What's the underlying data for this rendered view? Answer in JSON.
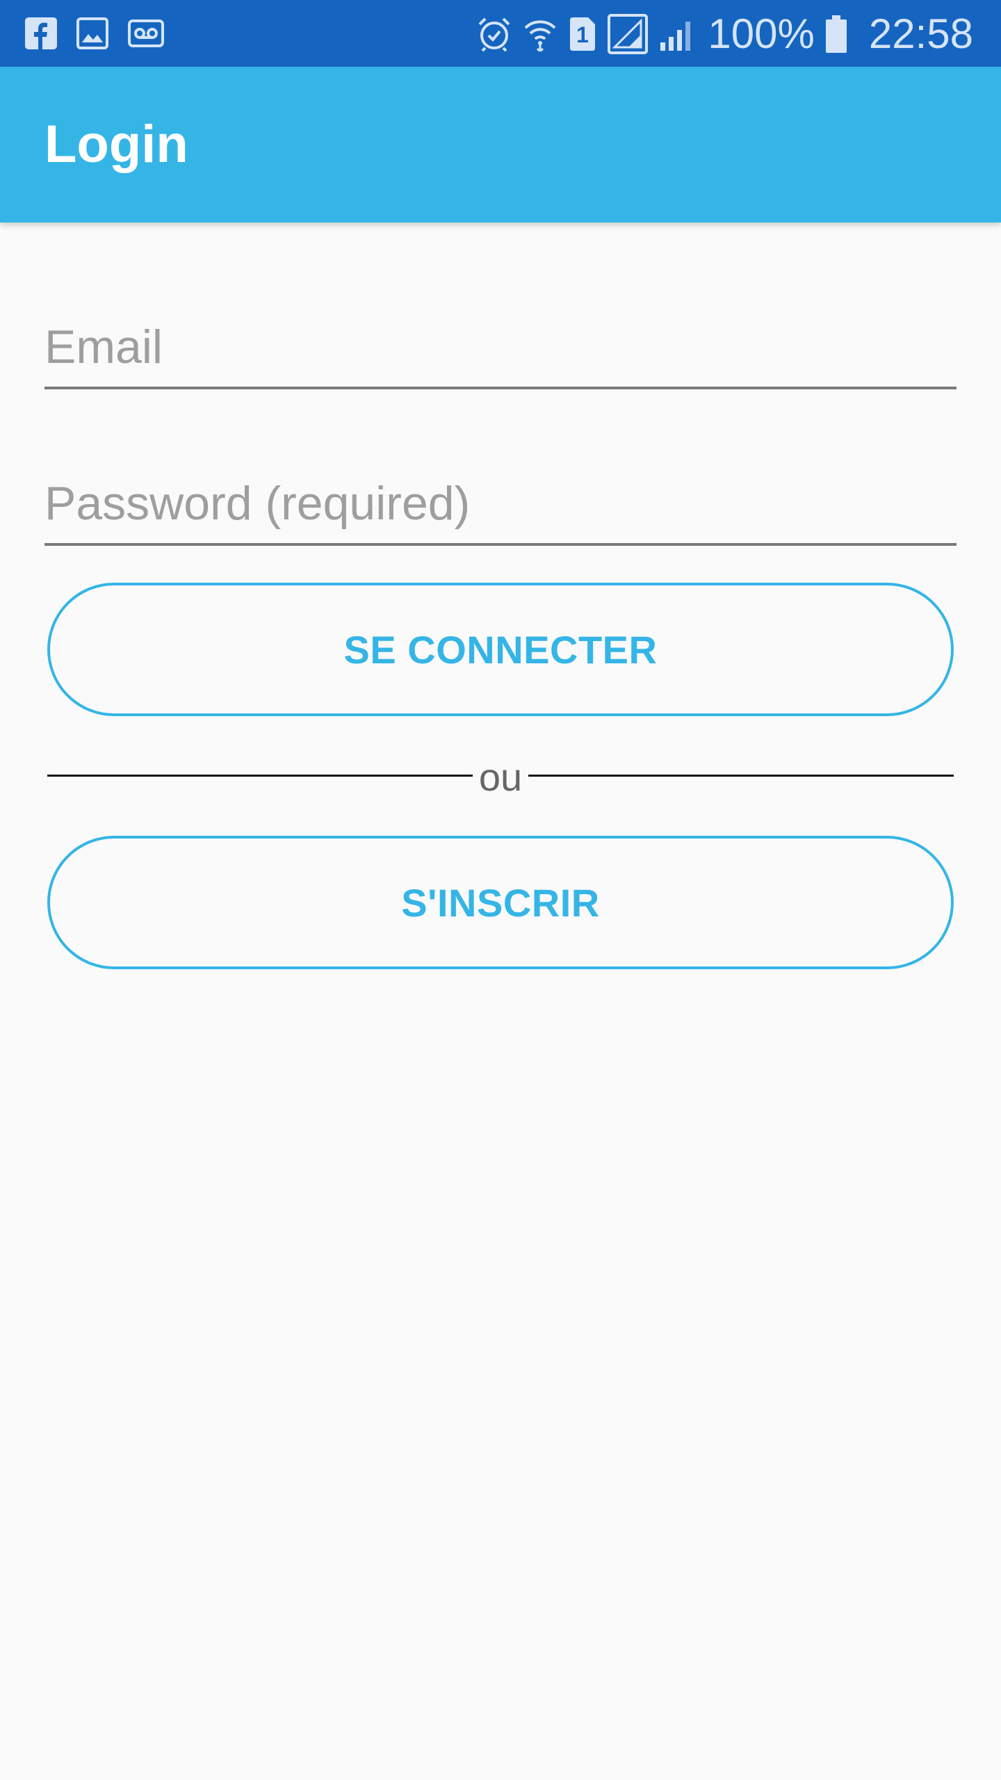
{
  "status_bar": {
    "battery_percent": "100%",
    "clock": "22:58",
    "sim_slot": "1",
    "icons": {
      "left": [
        "facebook-icon",
        "gallery-icon",
        "voicemail-icon"
      ],
      "right": [
        "alarm-icon",
        "wifi-icon",
        "sim-icon",
        "signal-sim1-icon",
        "signal-sim2-icon",
        "battery-icon"
      ]
    },
    "colors": {
      "background": "#1565c0",
      "foreground": "#d6e4f7"
    }
  },
  "app_bar": {
    "title": "Login",
    "color": "#35b5e6"
  },
  "form": {
    "email": {
      "value": "",
      "placeholder": "Email"
    },
    "password": {
      "value": "",
      "placeholder": "Password (required)"
    }
  },
  "actions": {
    "login_label": "SE CONNECTER",
    "divider_label": "ou",
    "signup_label": "S'INSCRIR"
  },
  "colors": {
    "accent": "#35b5e6",
    "background": "#fafafa",
    "field_underline": "#7a7a7a",
    "placeholder": "#9e9e9e"
  }
}
